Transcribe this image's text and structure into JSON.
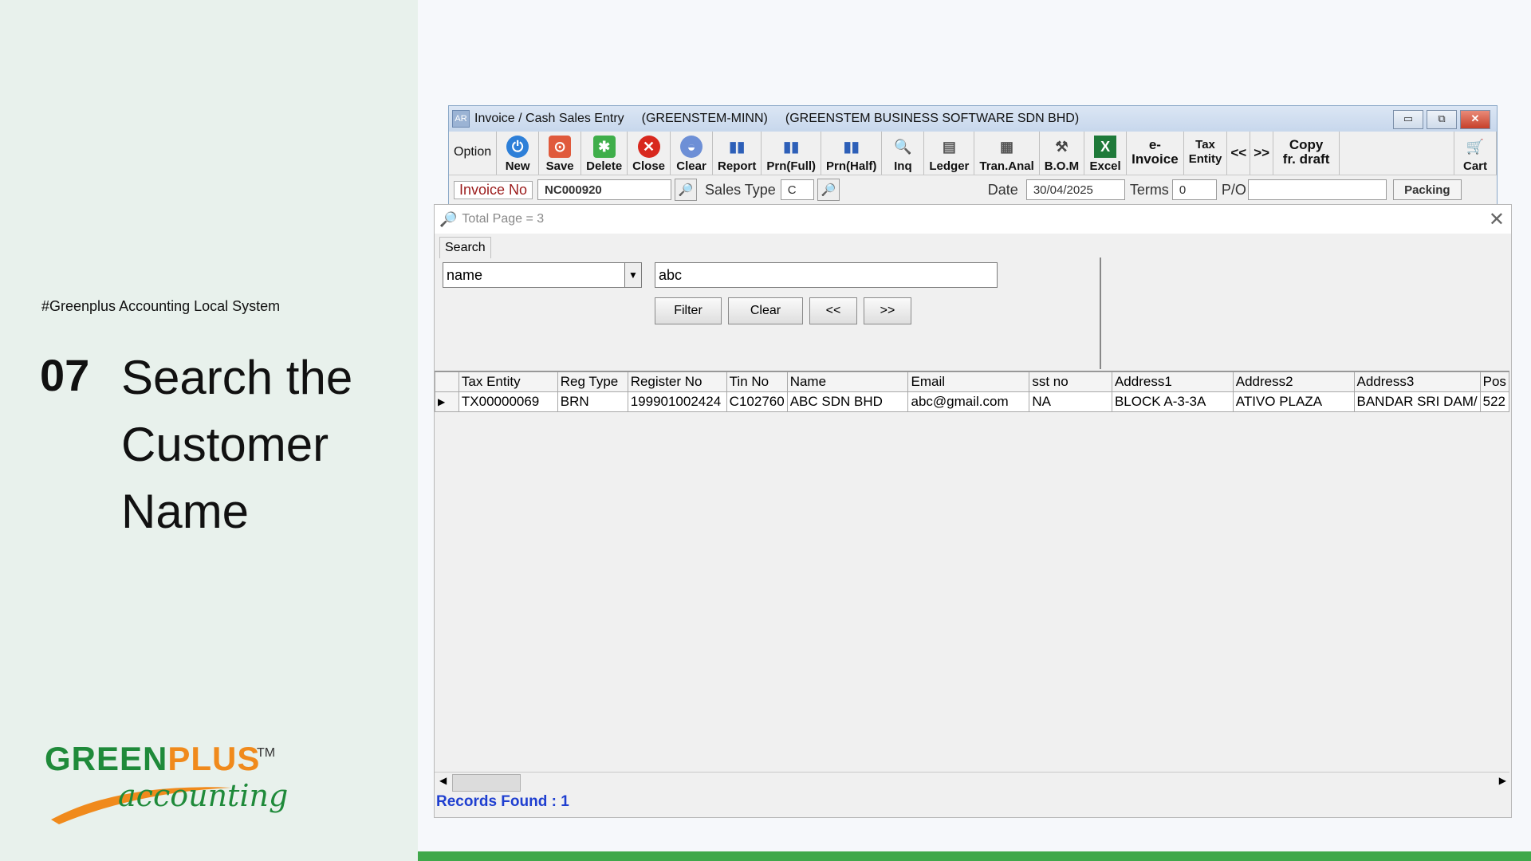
{
  "slide": {
    "hashtag": "#Greenplus Accounting Local System",
    "step_number": "07",
    "step_title": "Search the Customer Name",
    "logo": {
      "text_a": "GREEN",
      "text_b": "PLUS",
      "tm": "TM",
      "sub": "accounting",
      "color_green": "#1f8a3a",
      "color_orange": "#f08a1c"
    }
  },
  "window": {
    "app_icon": "AR",
    "title": "Invoice / Cash Sales Entry",
    "user": "(GREENSTEM-MINN)",
    "company": "(GREENSTEM BUSINESS SOFTWARE SDN BHD)"
  },
  "toolbar": {
    "option": "Option",
    "new": "New",
    "save": "Save",
    "delete": "Delete",
    "close": "Close",
    "clear": "Clear",
    "report": "Report",
    "prn_full": "Prn(Full)",
    "prn_half": "Prn(Half)",
    "inq": "Inq",
    "ledger": "Ledger",
    "tran_anal": "Tran.Anal",
    "bom": "B.O.M",
    "excel": "Excel",
    "e_invoice_1": "e-",
    "e_invoice_2": "Invoice",
    "tax_entity_1": "Tax",
    "tax_entity_2": "Entity",
    "prev": "<<",
    "next": ">>",
    "copy_1": "Copy",
    "copy_2": "fr. draft",
    "cart": "Cart"
  },
  "fields": {
    "invoice_no_label": "Invoice No",
    "invoice_no": "NC000920",
    "sales_type_label": "Sales Type",
    "sales_type": "C",
    "date_label": "Date",
    "date": "30/04/2025",
    "terms_label": "Terms",
    "terms": "0",
    "po_label": "P/O",
    "po": "",
    "packing": "Packing"
  },
  "popup": {
    "title": "Total Page = 3",
    "tab": "Search",
    "field_select": "name",
    "search_text": "abc",
    "filter": "Filter",
    "clear": "Clear",
    "prev": "<<",
    "next": ">>",
    "columns": [
      "Tax Entity",
      "Reg Type",
      "Register No",
      "Tin No",
      "Name",
      "Email",
      "sst no",
      "Address1",
      "Address2",
      "Address3",
      "Pos"
    ],
    "rows": [
      [
        "TX00000069",
        "BRN",
        "199901002424",
        "C102760",
        "ABC SDN BHD",
        "abc@gmail.com",
        "NA",
        "BLOCK A-3-3A",
        "ATIVO PLAZA",
        "BANDAR SRI DAM/",
        "522"
      ]
    ],
    "records_found": "Records Found : 1"
  }
}
